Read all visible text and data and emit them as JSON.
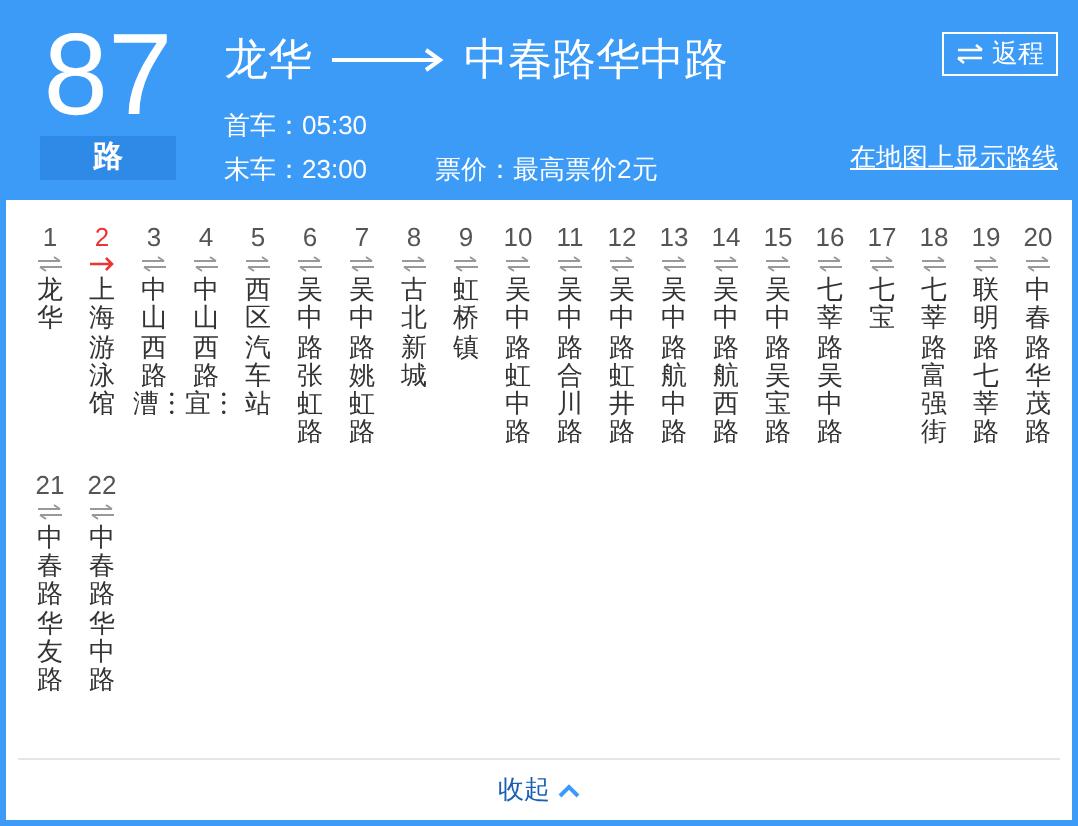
{
  "route": {
    "number": "87",
    "suffix": "路",
    "from": "龙华",
    "to": "中春路华中路",
    "first_bus": "首车：05:30",
    "last_bus": "末车：23:00",
    "fare": "票价：最高票价2元",
    "return_button": "返程",
    "map_link": "在地图上显示路线"
  },
  "stops": [
    {
      "index": "1",
      "name": "龙华",
      "selected": false
    },
    {
      "index": "2",
      "name": "上海游泳馆",
      "selected": true
    },
    {
      "index": "3",
      "name": "中山西路漕︙",
      "selected": false
    },
    {
      "index": "4",
      "name": "中山西路宜︙",
      "selected": false
    },
    {
      "index": "5",
      "name": "西区汽车站",
      "selected": false
    },
    {
      "index": "6",
      "name": "吴中路张虹路",
      "selected": false
    },
    {
      "index": "7",
      "name": "吴中路姚虹路",
      "selected": false
    },
    {
      "index": "8",
      "name": "古北新城",
      "selected": false
    },
    {
      "index": "9",
      "name": "虹桥镇",
      "selected": false
    },
    {
      "index": "10",
      "name": "吴中路虹中路",
      "selected": false
    },
    {
      "index": "11",
      "name": "吴中路合川路",
      "selected": false
    },
    {
      "index": "12",
      "name": "吴中路虹井路",
      "selected": false
    },
    {
      "index": "13",
      "name": "吴中路航中路",
      "selected": false
    },
    {
      "index": "14",
      "name": "吴中路航西路",
      "selected": false
    },
    {
      "index": "15",
      "name": "吴中路吴宝路",
      "selected": false
    },
    {
      "index": "16",
      "name": "七莘路吴中路",
      "selected": false
    },
    {
      "index": "17",
      "name": "七宝",
      "selected": false
    },
    {
      "index": "18",
      "name": "七莘路富强街",
      "selected": false
    },
    {
      "index": "19",
      "name": "联明路七莘路",
      "selected": false
    },
    {
      "index": "20",
      "name": "中春路华茂路",
      "selected": false
    },
    {
      "index": "21",
      "name": "中春路华友路",
      "selected": false
    },
    {
      "index": "22",
      "name": "中春路华中路",
      "selected": false
    }
  ],
  "collapse_button": "收起"
}
